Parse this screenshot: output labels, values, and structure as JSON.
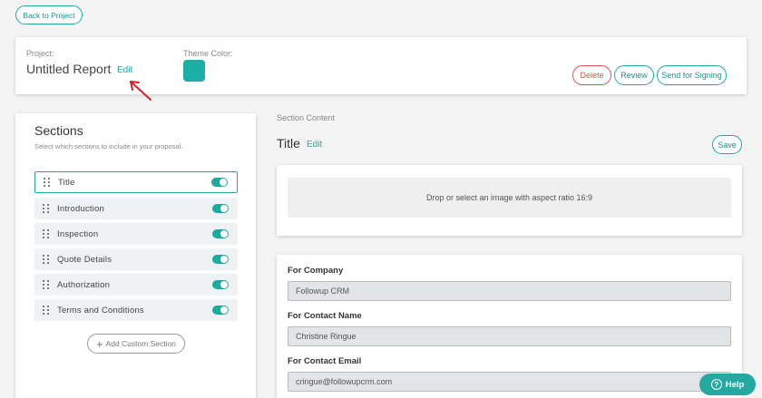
{
  "nav": {
    "back_label": "Back to Project"
  },
  "header": {
    "project_label": "Project:",
    "project_name": "Untitled Report",
    "edit_label": "Edit",
    "theme_label": "Theme Color:",
    "theme_color": "#1aaea5",
    "delete_label": "Delete",
    "review_label": "Review",
    "send_label": "Send for Signing"
  },
  "sections": {
    "title": "Sections",
    "subtitle": "Select which sections to include in your proposal.",
    "items": [
      {
        "label": "Title",
        "enabled": true
      },
      {
        "label": "Introduction",
        "enabled": true
      },
      {
        "label": "Inspection",
        "enabled": true
      },
      {
        "label": "Quote Details",
        "enabled": true
      },
      {
        "label": "Authorization",
        "enabled": true
      },
      {
        "label": "Terms and Conditions",
        "enabled": true
      }
    ],
    "add_label": "Add Custom Section"
  },
  "content": {
    "section_content_label": "Section Content",
    "heading": "Title",
    "edit_label": "Edit",
    "save_label": "Save",
    "dropzone_text": "Drop or select an image with aspect ratio 16:9",
    "fields": [
      {
        "label": "For Company",
        "value": "Followup CRM"
      },
      {
        "label": "For Contact Name",
        "value": "Christine Ringue"
      },
      {
        "label": "For Contact Email",
        "value": "cringue@followupcrm.com"
      }
    ]
  },
  "help": {
    "label": "Help"
  },
  "colors": {
    "accent": "#1fa8a0",
    "danger": "#d9534f",
    "arrow": "#d22020"
  }
}
